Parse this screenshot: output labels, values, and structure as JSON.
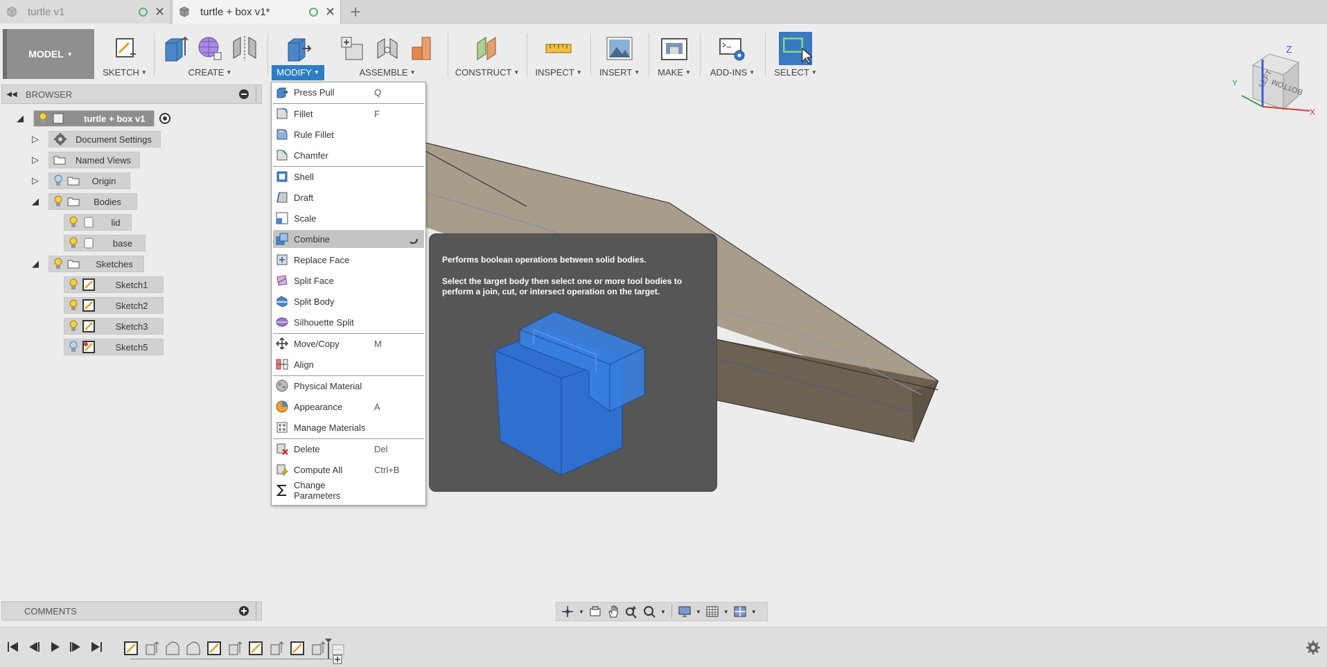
{
  "tabs": [
    {
      "label": "turtle v1",
      "active": false
    },
    {
      "label": "turtle + box v1*",
      "active": true
    }
  ],
  "toolbar": {
    "workspace": "MODEL",
    "groups": [
      {
        "label": "SKETCH"
      },
      {
        "label": "CREATE"
      },
      {
        "label": "MODIFY",
        "active": true
      },
      {
        "label": "ASSEMBLE"
      },
      {
        "label": "CONSTRUCT"
      },
      {
        "label": "INSPECT"
      },
      {
        "label": "INSERT"
      },
      {
        "label": "MAKE"
      },
      {
        "label": "ADD-INS"
      },
      {
        "label": "SELECT"
      }
    ]
  },
  "browser": {
    "title": "BROWSER",
    "root": "turtle + box v1",
    "items": [
      {
        "label": "Document Settings"
      },
      {
        "label": "Named Views"
      },
      {
        "label": "Origin"
      },
      {
        "label": "Bodies"
      },
      {
        "label": "lid"
      },
      {
        "label": "base"
      },
      {
        "label": "Sketches"
      },
      {
        "label": "Sketch1"
      },
      {
        "label": "Sketch2"
      },
      {
        "label": "Sketch3"
      },
      {
        "label": "Sketch5"
      }
    ]
  },
  "menu": {
    "items": [
      {
        "label": "Press Pull",
        "shortcut": "Q"
      },
      {
        "label": "Fillet",
        "shortcut": "F"
      },
      {
        "label": "Rule Fillet",
        "shortcut": ""
      },
      {
        "label": "Chamfer",
        "shortcut": ""
      },
      {
        "label": "Shell",
        "shortcut": ""
      },
      {
        "label": "Draft",
        "shortcut": ""
      },
      {
        "label": "Scale",
        "shortcut": ""
      },
      {
        "label": "Combine",
        "shortcut": "",
        "highlighted": true
      },
      {
        "label": "Replace Face",
        "shortcut": ""
      },
      {
        "label": "Split Face",
        "shortcut": ""
      },
      {
        "label": "Split Body",
        "shortcut": ""
      },
      {
        "label": "Silhouette Split",
        "shortcut": ""
      },
      {
        "label": "Move/Copy",
        "shortcut": "M"
      },
      {
        "label": "Align",
        "shortcut": ""
      },
      {
        "label": "Physical Material",
        "shortcut": ""
      },
      {
        "label": "Appearance",
        "shortcut": "A"
      },
      {
        "label": "Manage Materials",
        "shortcut": ""
      },
      {
        "label": "Delete",
        "shortcut": "Del"
      },
      {
        "label": "Compute All",
        "shortcut": "Ctrl+B"
      },
      {
        "label": "Change Parameters",
        "shortcut": ""
      }
    ]
  },
  "tooltip": {
    "line1": "Performs boolean operations between solid bodies.",
    "line2": "Select the target body then select one or more tool bodies to perform a join, cut, or intersect operation on the target."
  },
  "viewcube": {
    "left": "LEFT",
    "bottom": "BOTTOM",
    "z": "Z",
    "x": "X",
    "y": "Y"
  },
  "comments": {
    "title": "COMMENTS"
  },
  "colors": {
    "accent": "#2e7dc7",
    "tooltip_bg": "#565656",
    "body": "#9e9280",
    "selected": "#8e8e8e"
  }
}
